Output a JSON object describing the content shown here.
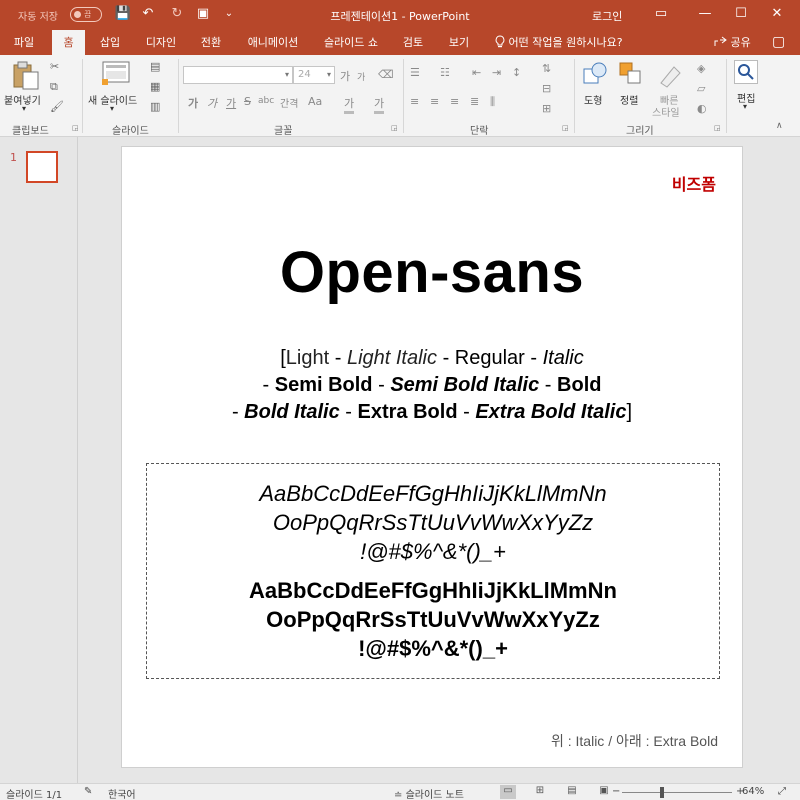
{
  "titlebar": {
    "autosave_label": "자동 저장",
    "autosave_state": "끔",
    "save_icon": "💾",
    "undo_icon": "↶",
    "redo_icon": "↻",
    "present_icon": "▣",
    "customize_icon": "⌄",
    "title": "프레젠테이션1  -  PowerPoint",
    "login": "로그인",
    "ribbon_options_icon": "▭",
    "minimize_icon": "—",
    "maximize_icon": "☐",
    "close_icon": "✕"
  },
  "tabs": {
    "items": [
      "파일",
      "홈",
      "삽입",
      "디자인",
      "전환",
      "애니메이션",
      "슬라이드 쇼",
      "검토",
      "보기"
    ],
    "active": "홈",
    "tellme": "어떤 작업을 원하시나요?",
    "share": "공유",
    "comment_icon": "▢"
  },
  "ribbon": {
    "clipboard": {
      "label": "클립보드",
      "paste": "붙여넣기",
      "paste_arrow": "▾"
    },
    "slides": {
      "label": "슬라이드",
      "new_slide": "새 슬라이드",
      "new_slide_arrow": "▾"
    },
    "font": {
      "label": "글꼴",
      "font_name": "",
      "font_size": "24",
      "grow": "가",
      "shrink": "가",
      "bold": "가",
      "italic": "가",
      "underline": "가",
      "strike": "S",
      "shadow": "abc",
      "spacing": "간격",
      "case": "Aa",
      "highlight": "가",
      "color": "가"
    },
    "paragraph": {
      "label": "단락"
    },
    "drawing": {
      "label": "그리기",
      "shapes": "도형",
      "arrange": "정렬",
      "quick_styles_line1": "빠른",
      "quick_styles_line2": "스타일"
    },
    "editing": {
      "label": "편집",
      "editing_arrow": "▾"
    }
  },
  "thumbnails": {
    "slide_number": "1"
  },
  "slide": {
    "brand": "비즈폼",
    "title": "Open-sans",
    "weights": {
      "open_bracket": "[",
      "light": "Light",
      "light_italic": "Light Italic",
      "regular": "Regular",
      "italic": "Italic",
      "semi_bold": "Semi Bold",
      "semi_bold_italic": "Semi Bold Italic",
      "bold": "Bold",
      "bold_italic": "Bold Italic",
      "extra_bold": "Extra Bold",
      "extra_bold_italic": "Extra Bold Italic",
      "close_bracket": "]",
      "separator": " - "
    },
    "samples": {
      "italic_lines": [
        "AaBbCcDdEeFfGgHhIiJjKkLlMmNn",
        "OoPpQqRrSsTtUuVvWwXxYyZz",
        "!@#$%^&*()_+"
      ],
      "extrabold_lines": [
        "AaBbCcDdEeFfGgHhIiJjKkLlMmNn",
        "OoPpQqRrSsTtUuVvWwXxYyZz",
        "!@#$%^&*()_+"
      ]
    },
    "caption": "위 : Italic / 아래 : Extra Bold"
  },
  "status": {
    "slide_count": "슬라이드 1/1",
    "language": "한국어",
    "notes": "슬라이드 노트",
    "zoom_minus": "−",
    "zoom_plus": "+",
    "zoom_value": "64%",
    "zoom_level": 0.64
  },
  "colors": {
    "accent": "#b7472a",
    "brand": "#c00000",
    "thumb_border": "#d24726"
  }
}
